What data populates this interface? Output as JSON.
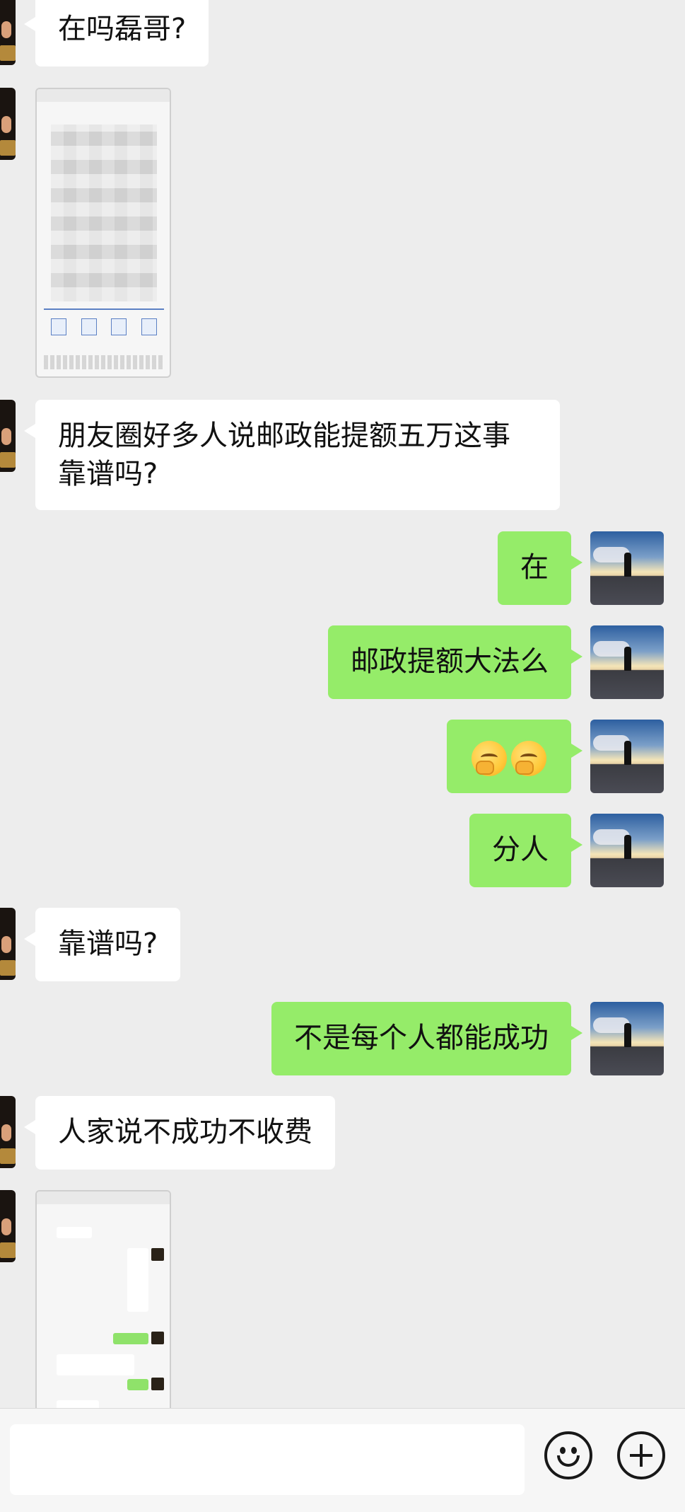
{
  "chat": {
    "messages": [
      {
        "side": "left",
        "type": "text",
        "text": "在吗磊哥?"
      },
      {
        "side": "left",
        "type": "image",
        "alt": "screenshot"
      },
      {
        "side": "left",
        "type": "text",
        "text": "朋友圈好多人说邮政能提额五万这事靠谱吗?"
      },
      {
        "side": "right",
        "type": "text",
        "text": "在"
      },
      {
        "side": "right",
        "type": "text",
        "text": "邮政提额大法么"
      },
      {
        "side": "right",
        "type": "emoji",
        "icons": [
          "thinking-face-icon",
          "thinking-face-icon"
        ]
      },
      {
        "side": "right",
        "type": "text",
        "text": "分人"
      },
      {
        "side": "left",
        "type": "text",
        "text": "靠谱吗?"
      },
      {
        "side": "right",
        "type": "text",
        "text": "不是每个人都能成功"
      },
      {
        "side": "left",
        "type": "text",
        "text": "人家说不成功不收费"
      },
      {
        "side": "left",
        "type": "image",
        "alt": "chat screenshot"
      }
    ]
  },
  "input_bar": {
    "value": "",
    "placeholder": "",
    "icons": [
      "emoji-icon",
      "plus-icon"
    ]
  },
  "colors": {
    "background": "#ededed",
    "sent_bubble": "#95ec69",
    "received_bubble": "#ffffff"
  }
}
